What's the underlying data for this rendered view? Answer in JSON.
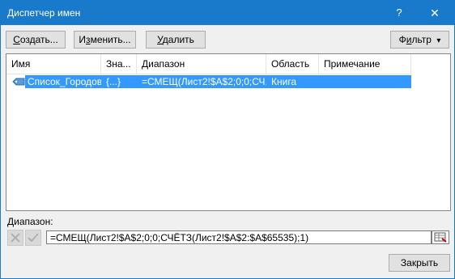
{
  "window": {
    "title": "Диспетчер имен",
    "help_glyph": "?",
    "close_glyph": "✕"
  },
  "toolbar": {
    "create": {
      "text": "Создать...",
      "mnemonic": "С",
      "rest": "оздать..."
    },
    "edit": {
      "pre": "И",
      "mnemonic": "з",
      "rest": "менить..."
    },
    "delete": {
      "mnemonic": "У",
      "rest": "далить"
    },
    "filter": {
      "pre": "Ф",
      "mnemonic": "и",
      "rest": "льтр",
      "arrow": "▾"
    }
  },
  "table": {
    "headers": [
      "Имя",
      "Зна...",
      "Диапазон",
      "Область",
      "Примечание"
    ],
    "rows": [
      {
        "name": "Список_Городов",
        "value": "{...}",
        "range": "=СМЕЩ(Лист2!$A$2;0;0;СЧ...",
        "scope": "Книга",
        "comment": ""
      }
    ]
  },
  "range_section": {
    "label": "Диапазон:",
    "formula": "=СМЕЩ(Лист2!$A$2;0;0;СЧЁТЗ(Лист2!$A$2:$A$65535);1)"
  },
  "footer": {
    "close_label": "Закрыть"
  },
  "colors": {
    "title_bar": "#1979ca",
    "selection": "#3399ff",
    "window_bg": "#f0f0f0"
  }
}
